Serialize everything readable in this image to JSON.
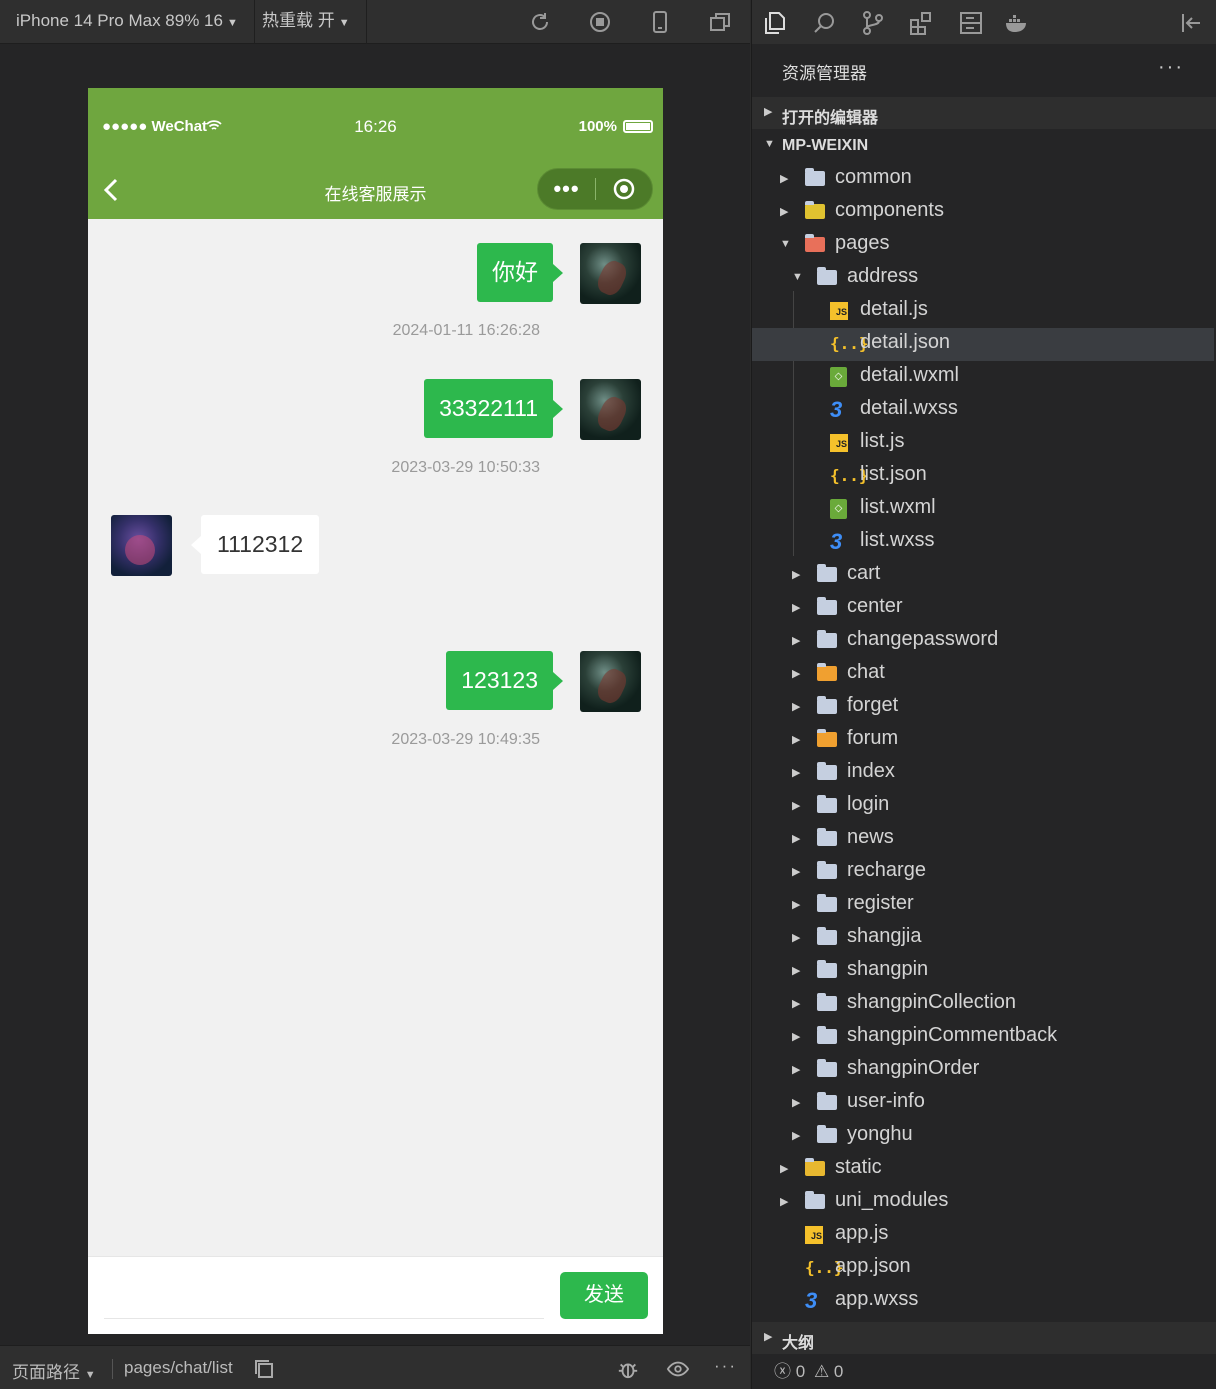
{
  "simulator": {
    "device_label": "iPhone 14 Pro Max 89% 16",
    "hotreload_label": "热重载 开",
    "status": {
      "carrier": "●●●●● WeChat",
      "time": "16:26",
      "battery": "100%"
    },
    "nav_title": "在线客服展示",
    "messages": [
      {
        "side": "right",
        "text": "你好",
        "time": "2024-01-11 16:26:28"
      },
      {
        "side": "right",
        "text": "33322111",
        "time": "2023-03-29 10:50:33"
      },
      {
        "side": "left",
        "text": "1112312",
        "time": ""
      },
      {
        "side": "right",
        "text": "123123",
        "time": "2023-03-29 10:49:35"
      }
    ],
    "send_label": "发送"
  },
  "bottom": {
    "path_label": "页面路径",
    "path": "pages/chat/list"
  },
  "explorer": {
    "title": "资源管理器",
    "more": "···",
    "section_open_editors": "打开的编辑器",
    "section_project": "MP-WEIXIN",
    "section_outline": "大纲",
    "tree": [
      {
        "label": "common",
        "icon": "folder-icon"
      },
      {
        "label": "components",
        "icon": "components-folder-icon"
      },
      {
        "label": "pages",
        "icon": "pages-folder-open-icon"
      },
      {
        "label": "address",
        "icon": "folder-open-icon"
      },
      {
        "label": "detail.js",
        "icon": "js-file-icon"
      },
      {
        "label": "detail.json",
        "icon": "json-file-icon"
      },
      {
        "label": "detail.wxml",
        "icon": "wxml-file-icon"
      },
      {
        "label": "detail.wxss",
        "icon": "wxss-file-icon"
      },
      {
        "label": "list.js",
        "icon": "js-file-icon"
      },
      {
        "label": "list.json",
        "icon": "json-file-icon"
      },
      {
        "label": "list.wxml",
        "icon": "wxml-file-icon"
      },
      {
        "label": "list.wxss",
        "icon": "wxss-file-icon"
      },
      {
        "label": "cart",
        "icon": "folder-icon"
      },
      {
        "label": "center",
        "icon": "folder-icon"
      },
      {
        "label": "changepassword",
        "icon": "folder-icon"
      },
      {
        "label": "chat",
        "icon": "chat-folder-icon"
      },
      {
        "label": "forget",
        "icon": "folder-icon"
      },
      {
        "label": "forum",
        "icon": "forum-folder-icon"
      },
      {
        "label": "index",
        "icon": "folder-icon"
      },
      {
        "label": "login",
        "icon": "folder-icon"
      },
      {
        "label": "news",
        "icon": "folder-icon"
      },
      {
        "label": "recharge",
        "icon": "folder-icon"
      },
      {
        "label": "register",
        "icon": "folder-icon"
      },
      {
        "label": "shangjia",
        "icon": "folder-icon"
      },
      {
        "label": "shangpin",
        "icon": "folder-icon"
      },
      {
        "label": "shangpinCollection",
        "icon": "folder-icon"
      },
      {
        "label": "shangpinCommentback",
        "icon": "folder-icon"
      },
      {
        "label": "shangpinOrder",
        "icon": "folder-icon"
      },
      {
        "label": "user-info",
        "icon": "folder-icon"
      },
      {
        "label": "yonghu",
        "icon": "folder-icon"
      },
      {
        "label": "static",
        "icon": "static-folder-icon"
      },
      {
        "label": "uni_modules",
        "icon": "folder-icon"
      },
      {
        "label": "app.js",
        "icon": "js-file-icon"
      },
      {
        "label": "app.json",
        "icon": "json-file-icon"
      },
      {
        "label": "app.wxss",
        "icon": "wxss-file-icon"
      }
    ],
    "errors": "0",
    "warnings": "0"
  },
  "colors": {
    "wechat_green": "#6fa63f",
    "bubble_green": "#2db84d",
    "selected_row": "#3a3d41"
  }
}
